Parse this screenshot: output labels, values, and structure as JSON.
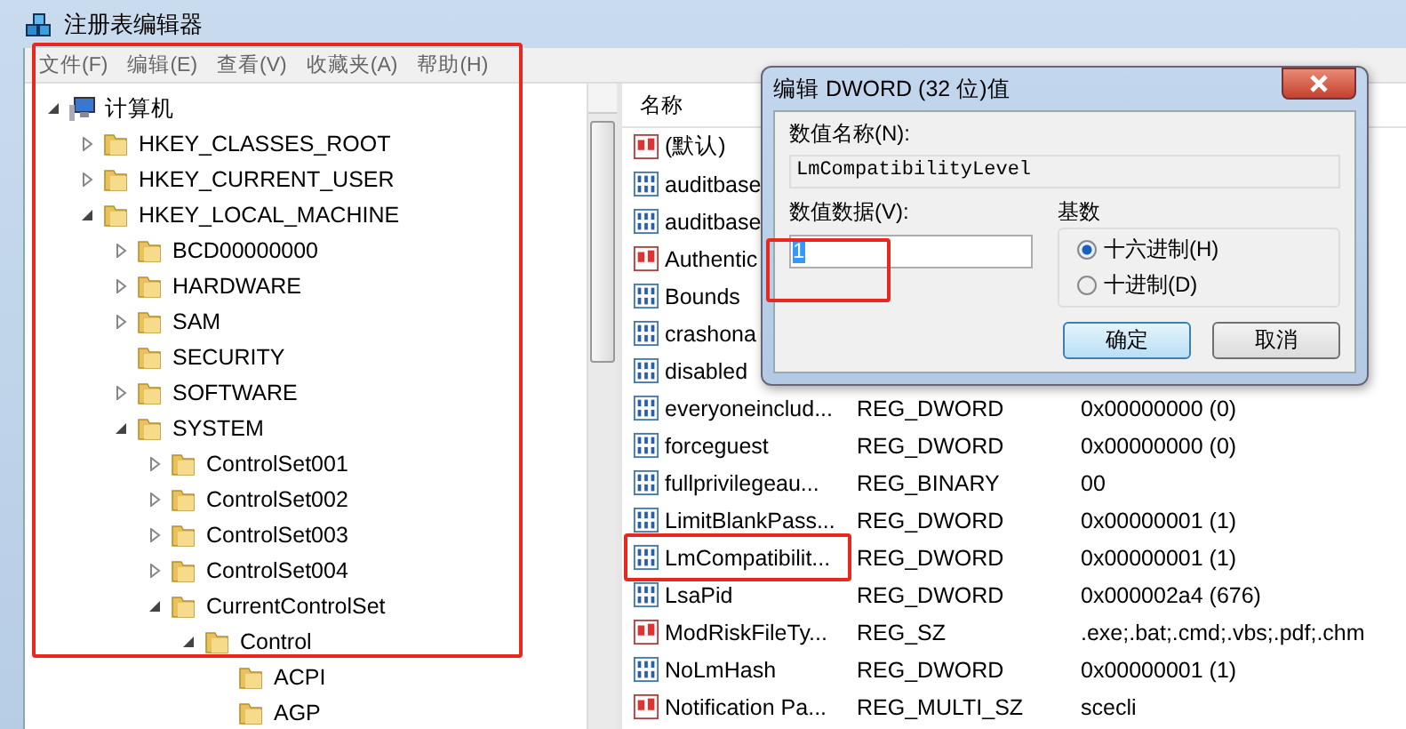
{
  "window": {
    "title": "注册表编辑器"
  },
  "menu": [
    "文件(F)",
    "编辑(E)",
    "查看(V)",
    "收藏夹(A)",
    "帮助(H)"
  ],
  "tree": [
    {
      "label": "计算机",
      "kind": "computer",
      "expandable": true,
      "expanded": true,
      "children": [
        {
          "label": "HKEY_CLASSES_ROOT",
          "kind": "folder",
          "expandable": true,
          "expanded": false
        },
        {
          "label": "HKEY_CURRENT_USER",
          "kind": "folder",
          "expandable": true,
          "expanded": false
        },
        {
          "label": "HKEY_LOCAL_MACHINE",
          "kind": "folder",
          "expandable": true,
          "expanded": true,
          "children": [
            {
              "label": "BCD00000000",
              "kind": "folder",
              "expandable": true,
              "expanded": false
            },
            {
              "label": "HARDWARE",
              "kind": "folder",
              "expandable": true,
              "expanded": false
            },
            {
              "label": "SAM",
              "kind": "folder",
              "expandable": true,
              "expanded": false
            },
            {
              "label": "SECURITY",
              "kind": "folder",
              "expandable": false,
              "expanded": false
            },
            {
              "label": "SOFTWARE",
              "kind": "folder",
              "expandable": true,
              "expanded": false
            },
            {
              "label": "SYSTEM",
              "kind": "folder",
              "expandable": true,
              "expanded": true,
              "children": [
                {
                  "label": "ControlSet001",
                  "kind": "folder",
                  "expandable": true,
                  "expanded": false
                },
                {
                  "label": "ControlSet002",
                  "kind": "folder",
                  "expandable": true,
                  "expanded": false
                },
                {
                  "label": "ControlSet003",
                  "kind": "folder",
                  "expandable": true,
                  "expanded": false
                },
                {
                  "label": "ControlSet004",
                  "kind": "folder",
                  "expandable": true,
                  "expanded": false
                },
                {
                  "label": "CurrentControlSet",
                  "kind": "folder",
                  "expandable": true,
                  "expanded": true,
                  "children": [
                    {
                      "label": "Control",
                      "kind": "folder",
                      "expandable": true,
                      "expanded": true,
                      "children": [
                        {
                          "label": "ACPI",
                          "kind": "folder",
                          "expandable": false,
                          "expanded": false
                        },
                        {
                          "label": "AGP",
                          "kind": "folder",
                          "expandable": false,
                          "expanded": false
                        }
                      ]
                    }
                  ]
                }
              ]
            }
          ]
        }
      ]
    }
  ],
  "list": {
    "columns": [
      "名称"
    ],
    "rows": [
      {
        "name": "(默认)",
        "kind": "string"
      },
      {
        "name": "auditbase",
        "kind": "binary"
      },
      {
        "name": "auditbase",
        "kind": "binary"
      },
      {
        "name": "Authentic",
        "kind": "string"
      },
      {
        "name": "Bounds",
        "kind": "binary"
      },
      {
        "name": "crashona",
        "kind": "binary"
      },
      {
        "name": "disabled",
        "kind": "binary"
      },
      {
        "name": "everyoneinclud...",
        "kind": "binary",
        "type": "REG_DWORD",
        "data": "0x00000000 (0)"
      },
      {
        "name": "forceguest",
        "kind": "binary",
        "type": "REG_DWORD",
        "data": "0x00000000 (0)"
      },
      {
        "name": "fullprivilegeau...",
        "kind": "binary",
        "type": "REG_BINARY",
        "data": "00"
      },
      {
        "name": "LimitBlankPass...",
        "kind": "binary",
        "type": "REG_DWORD",
        "data": "0x00000001 (1)"
      },
      {
        "name": "LmCompatibilit...",
        "kind": "binary",
        "type": "REG_DWORD",
        "data": "0x00000001 (1)"
      },
      {
        "name": "LsaPid",
        "kind": "binary",
        "type": "REG_DWORD",
        "data": "0x000002a4 (676)"
      },
      {
        "name": "ModRiskFileTy...",
        "kind": "string",
        "type": "REG_SZ",
        "data": ".exe;.bat;.cmd;.vbs;.pdf;.chm"
      },
      {
        "name": "NoLmHash",
        "kind": "binary",
        "type": "REG_DWORD",
        "data": "0x00000001 (1)"
      },
      {
        "name": "Notification Pa...",
        "kind": "string",
        "type": "REG_MULTI_SZ",
        "data": "scecli"
      }
    ]
  },
  "dialog": {
    "title": "编辑 DWORD (32 位)值",
    "name_label": "数值名称(N):",
    "name_value": "LmCompatibilityLevel",
    "data_label": "数值数据(V):",
    "data_value": "1",
    "base_label": "基数",
    "bases": [
      {
        "label": "十六进制(H)",
        "selected": true
      },
      {
        "label": "十进制(D)",
        "selected": false
      }
    ],
    "buttons": [
      {
        "label": "确定",
        "default": true
      },
      {
        "label": "取消",
        "default": false
      }
    ]
  }
}
